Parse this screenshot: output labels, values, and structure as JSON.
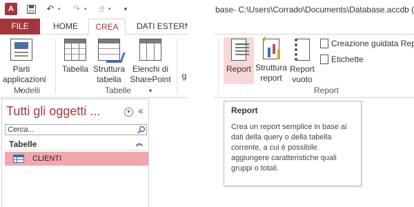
{
  "colors": {
    "accent": "#a4373a",
    "selected_item": "#f4a7ab",
    "hover_button": "#f7d7d7"
  },
  "left": {
    "qat": {
      "app_icon": "access-logo-icon",
      "app_letter": "A",
      "save_icon": "save-icon",
      "undo_icon": "undo-icon",
      "redo_icon": "redo-icon",
      "touch_icon": "touch-mode-icon",
      "customize_icon": "customize-qat-icon"
    },
    "tabs": [
      "FILE",
      "HOME",
      "CREA",
      "DATI ESTERNI"
    ],
    "ribbon": {
      "parts_label_1": "Parti",
      "parts_label_2": "applicazioni",
      "table_label": "Tabella",
      "struct_label_1": "Struttura",
      "struct_label_2": "tabella",
      "sp_label_1": "Elenchi di",
      "sp_label_2": "SharePoint",
      "cut_letter": "g",
      "group_modelli": "Modelli",
      "group_tabelle": "Tabelle"
    },
    "nav": {
      "title": "Tutti gli oggetti ...",
      "search_placeholder": "Cerca...",
      "group_title": "Tabelle",
      "items": [
        "CLIENTI"
      ]
    }
  },
  "right": {
    "window_title": "base- C:\\Users\\Corrado\\Documents\\Database.accdb (f",
    "ribbon": {
      "report_label": "Report",
      "rstruct_label_1": "Struttura",
      "rstruct_label_2": "report",
      "rempty_label_1": "Report",
      "rempty_label_2": "vuoto",
      "wizard_label": "Creazione guidata Repo",
      "labels_label": "Etichette",
      "group_report": "Report"
    },
    "tooltip": {
      "title": "Report",
      "body": "Crea un report semplice in base ai dati della query o della tabella corrente, a cui è possibile aggiungere caratteristiche quali gruppi o totali."
    }
  }
}
